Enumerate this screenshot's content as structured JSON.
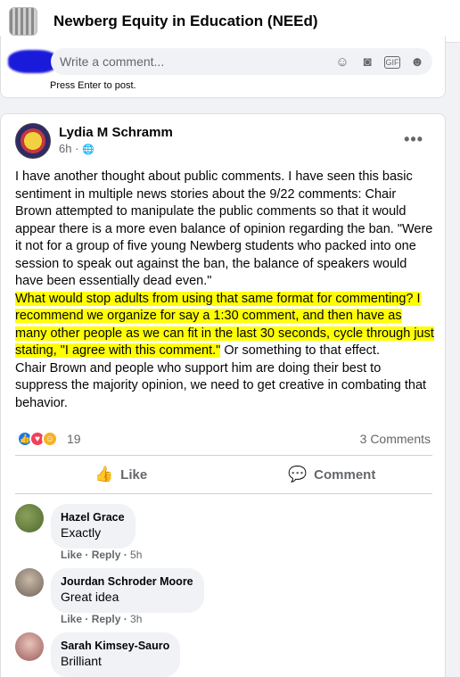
{
  "group": {
    "name": "Newberg Equity in Education (NEEd)"
  },
  "composer": {
    "placeholder": "Write a comment...",
    "hint": "Press Enter to post.",
    "icons": [
      "emoji-icon",
      "camera-icon",
      "gif-icon",
      "sticker-icon"
    ]
  },
  "post": {
    "author": "Lydia M Schramm",
    "time": "6h ·",
    "body": {
      "p1": "I have another thought about public comments.  I have seen this basic sentiment in multiple news stories about the 9/22 comments: Chair Brown attempted to manipulate the public comments so that it would appear there is a more even balance of opinion regarding the ban. \"Were it not for a group of five young Newberg students who packed into one session to speak out against the ban, the balance of speakers would have been essentially dead even.\"",
      "highlight": "What would stop adults from using that same format for commenting?  I recommend we organize for say a 1:30 comment, and then have as many other people as we can fit in the last 30 seconds, cycle through just stating, \"I agree with this comment.\"",
      "p2_tail": " Or something to that effect.",
      "p3": "Chair Brown and people who support him are doing their best to suppress the majority opinion, we need to get creative in combating that behavior."
    },
    "reaction_count": "19",
    "comment_count": "3 Comments",
    "actions": {
      "like": "Like",
      "comment": "Comment"
    }
  },
  "comments": [
    {
      "name": "Hazel Grace",
      "text": "Exactly",
      "like": "Like",
      "reply": "Reply",
      "time": "5h"
    },
    {
      "name": "Jourdan Schroder Moore",
      "text": "Great idea",
      "like": "Like",
      "reply": "Reply",
      "time": "3h"
    },
    {
      "name": "Sarah Kimsey-Sauro",
      "text": "Brilliant"
    }
  ],
  "colors": {
    "accent": "#1877f2",
    "highlight": "#ffff00",
    "muted": "#65676b"
  }
}
